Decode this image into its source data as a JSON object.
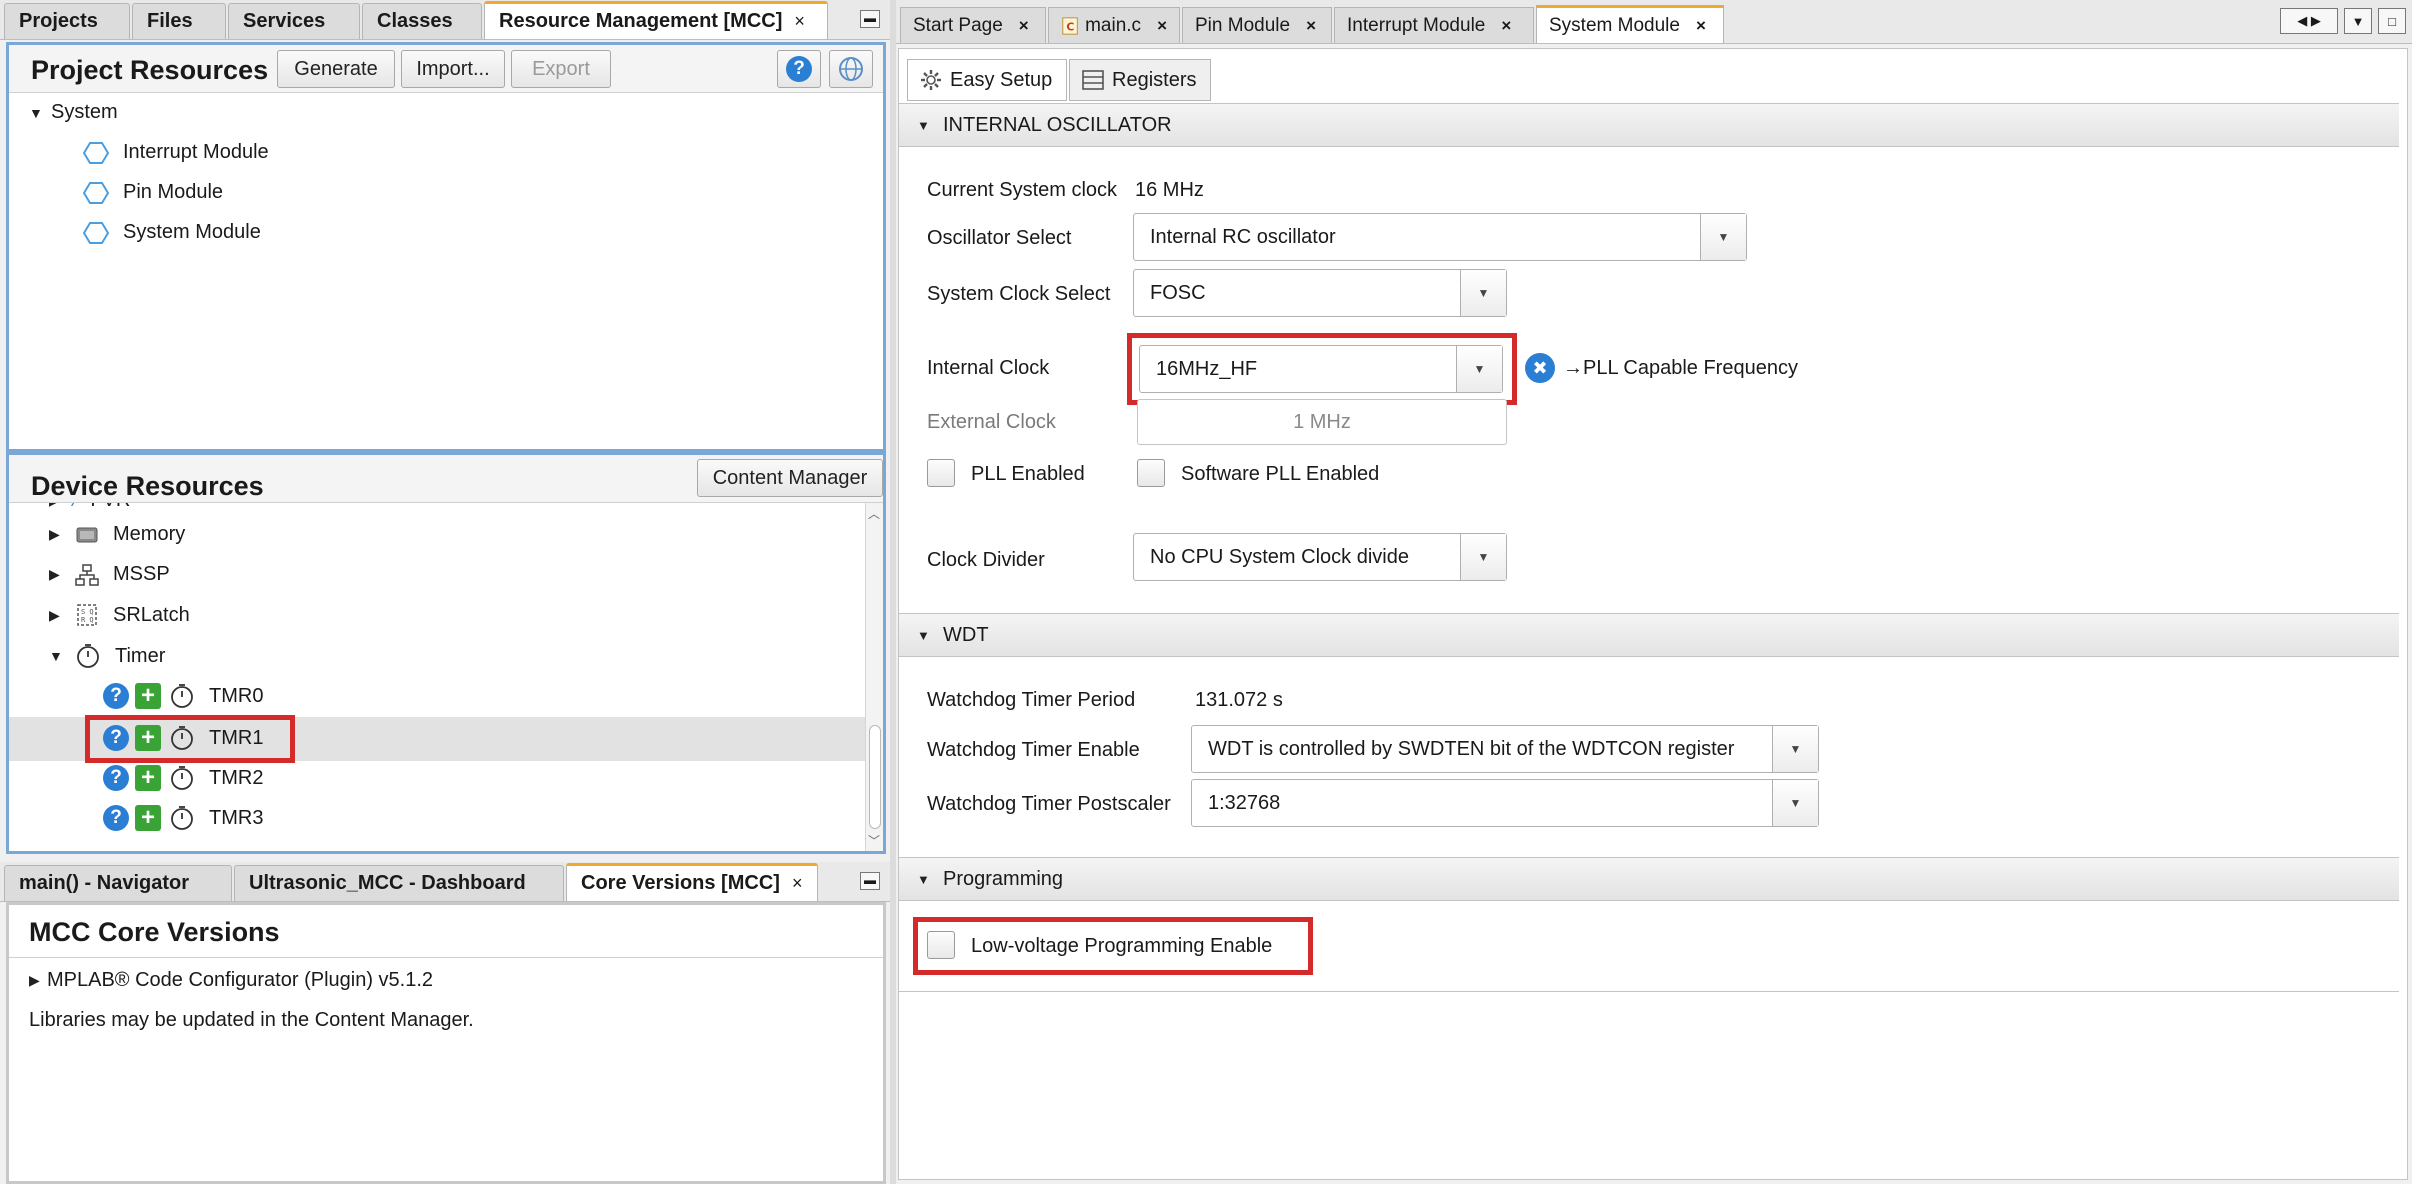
{
  "left_tabs": [
    {
      "label": "Projects"
    },
    {
      "label": "Files"
    },
    {
      "label": "Services"
    },
    {
      "label": "Classes"
    },
    {
      "label": "Resource Management [MCC]",
      "close": "×"
    }
  ],
  "project_resources": {
    "title": "Project Resources",
    "generate": "Generate",
    "import": "Import...",
    "export": "Export",
    "root": "System",
    "items": [
      "Interrupt Module",
      "Pin Module",
      "System Module"
    ]
  },
  "device_resources": {
    "title": "Device Resources",
    "content_manager": "Content Manager",
    "partial_item": "FVR",
    "items": [
      "Memory",
      "MSSP",
      "SRLatch",
      "Timer"
    ],
    "timers": [
      "TMR0",
      "TMR1",
      "TMR2",
      "TMR3"
    ]
  },
  "bottom_tabs": [
    {
      "label": "main() - Navigator"
    },
    {
      "label": "Ultrasonic_MCC - Dashboard"
    },
    {
      "label": "Core Versions [MCC]",
      "close": "×"
    }
  ],
  "core_versions": {
    "title": "MCC Core Versions",
    "plugin": "MPLAB® Code Configurator (Plugin) v5.1.2",
    "note": "Libraries may be updated in the Content Manager."
  },
  "editor_tabs": [
    {
      "label": "Start Page",
      "close": "×"
    },
    {
      "label": "main.c",
      "close": "×"
    },
    {
      "label": "Pin Module",
      "close": "×"
    },
    {
      "label": "Interrupt Module",
      "close": "×"
    },
    {
      "label": "System Module",
      "close": "×"
    }
  ],
  "sub_tabs": {
    "easy_setup": "Easy Setup",
    "registers": "Registers"
  },
  "internal_oscillator": {
    "section": "INTERNAL OSCILLATOR",
    "current_clock_label": "Current System clock",
    "current_clock_value": "16 MHz",
    "osc_select_label": "Oscillator Select",
    "osc_select_value": "Internal RC oscillator",
    "sys_clock_label": "System Clock Select",
    "sys_clock_value": "FOSC",
    "internal_clock_label": "Internal Clock",
    "internal_clock_value": "16MHz_HF",
    "pll_hint": "→PLL Capable Frequency",
    "external_clock_label": "External Clock",
    "external_clock_value": "1 MHz",
    "pll_enabled": "PLL Enabled",
    "software_pll": "Software PLL Enabled",
    "clock_divider_label": "Clock Divider",
    "clock_divider_value": "No CPU System Clock divide"
  },
  "wdt": {
    "section": "WDT",
    "period_label": "Watchdog Timer Period",
    "period_value": "131.072 s",
    "enable_label": "Watchdog Timer Enable",
    "enable_value": "WDT is controlled by SWDTEN bit of the WDTCON register",
    "postscaler_label": "Watchdog Timer Postscaler",
    "postscaler_value": "1:32768"
  },
  "programming": {
    "section": "Programming",
    "lvp": "Low-voltage Programming Enable"
  },
  "colors": {
    "accent_tab": "#f0a830",
    "highlight": "#d42a2a",
    "panel_border": "#7aa7d6",
    "help_blue": "#2a7fd4",
    "add_green": "#3aa335"
  }
}
